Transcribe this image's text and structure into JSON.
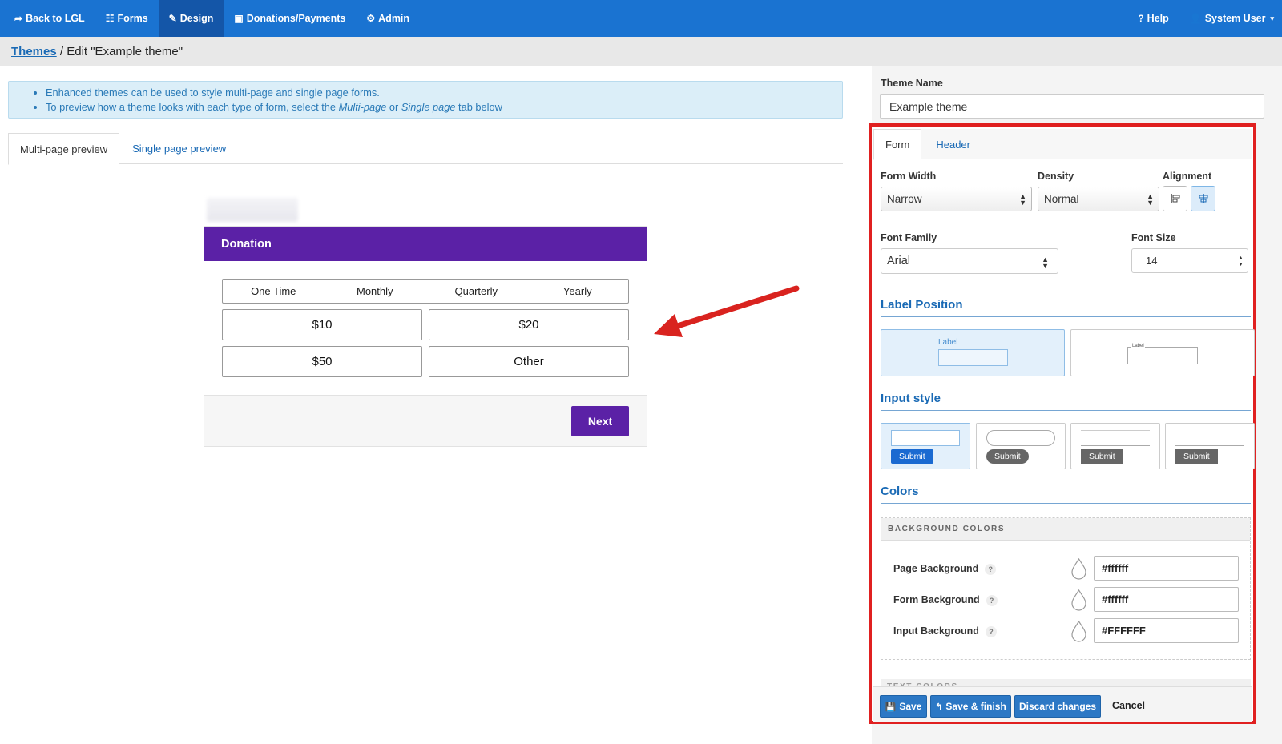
{
  "nav": {
    "back": "Back to LGL",
    "forms": "Forms",
    "design": "Design",
    "donations": "Donations/Payments",
    "admin": "Admin",
    "help": "Help",
    "user": "System User"
  },
  "breadcrumb": {
    "link": "Themes",
    "separator": " / ",
    "current": "Edit \"Example theme\""
  },
  "info": {
    "line1": "Enhanced themes can be used to style multi-page and single page forms.",
    "line2_pre": "To preview how a theme looks with each type of form, select the ",
    "line2_em1": "Multi-page",
    "line2_mid": " or ",
    "line2_em2": "Single page",
    "line2_post": " tab below"
  },
  "preview_tabs": {
    "multi": "Multi-page preview",
    "single": "Single page preview"
  },
  "form_preview": {
    "title": "Donation",
    "frequencies": [
      "One Time",
      "Monthly",
      "Quarterly",
      "Yearly"
    ],
    "amounts": [
      "$10",
      "$20",
      "$50",
      "Other"
    ],
    "next": "Next"
  },
  "theme_name": {
    "label": "Theme Name",
    "value": "Example theme"
  },
  "panel_tabs": {
    "form": "Form",
    "header": "Header"
  },
  "settings": {
    "form_width_label": "Form Width",
    "form_width_value": "Narrow",
    "density_label": "Density",
    "density_value": "Normal",
    "alignment_label": "Alignment",
    "font_family_label": "Font Family",
    "font_family_value": "Arial",
    "font_size_label": "Font Size",
    "font_size_value": "14"
  },
  "label_position": {
    "title": "Label Position",
    "above_label": "Label",
    "inline_label": "Label"
  },
  "input_style": {
    "title": "Input style",
    "submit": "Submit"
  },
  "colors": {
    "title": "Colors",
    "bg_header": "BACKGROUND COLORS",
    "rows": [
      {
        "label": "Page Background",
        "value": "#ffffff"
      },
      {
        "label": "Form Background",
        "value": "#ffffff"
      },
      {
        "label": "Input Background",
        "value": "#FFFFFF"
      }
    ],
    "help_mark": "?",
    "text_header": "TEXT COLORS"
  },
  "footer": {
    "save": "Save",
    "save_finish": "Save & finish",
    "discard": "Discard changes",
    "cancel": "Cancel"
  },
  "palette": {
    "nav_blue": "#1a73d1",
    "purple": "#5b21a6",
    "link_blue": "#1a6ab5",
    "highlight_red": "#e02020"
  }
}
